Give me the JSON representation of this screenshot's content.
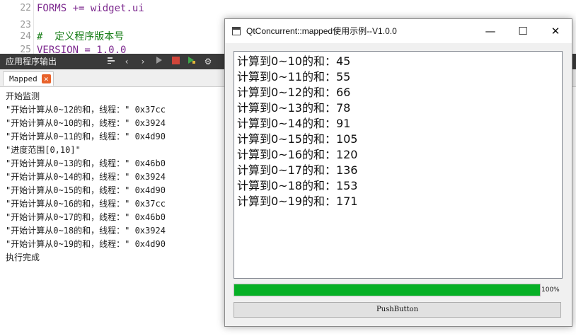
{
  "editor": {
    "lines": [
      {
        "num": "22",
        "text": "FORMS += widget.ui"
      },
      {
        "num": "23",
        "text": ""
      },
      {
        "num": "24",
        "text": "#  定义程序版本号"
      },
      {
        "num": "25",
        "text": "VERSION = 1.0.0"
      }
    ]
  },
  "output_pane": {
    "title": "应用程序输出",
    "tab_label": "Mapped",
    "tab_close": "✕",
    "log_lines": [
      "开始监测",
      "\"开始计算从0~12的和，线程：\" 0x37cc",
      "\"开始计算从0~10的和，线程：\" 0x3924",
      "\"开始计算从0~11的和，线程：\" 0x4d90",
      "\"进度范围[0,10]\"",
      "\"开始计算从0~13的和，线程：\" 0x46b0",
      "\"开始计算从0~14的和，线程：\" 0x3924",
      "\"开始计算从0~15的和，线程：\" 0x4d90",
      "\"开始计算从0~16的和，线程：\" 0x37cc",
      "\"开始计算从0~17的和，线程：\" 0x46b0",
      "\"开始计算从0~18的和，线程：\" 0x3924",
      "\"开始计算从0~19的和，线程：\" 0x4d90",
      "执行完成"
    ]
  },
  "dialog": {
    "title": "QtConcurrent::mapped使用示例--V1.0.0",
    "minimize": "—",
    "maximize": "☐",
    "close": "✕",
    "results": [
      "计算到0~10的和：45",
      "计算到0~11的和：55",
      "计算到0~12的和：66",
      "计算到0~13的和：78",
      "计算到0~14的和：91",
      "计算到0~15的和：105",
      "计算到0~16的和：120",
      "计算到0~17的和：136",
      "计算到0~18的和：153",
      "计算到0~19的和：171"
    ],
    "progress": {
      "value": 100,
      "label": "100%"
    },
    "button_label": "PushButton"
  },
  "colors": {
    "progress_fill": "#06b025",
    "toolbar_bg": "#3a3a3a",
    "tab_close_bg": "#e8622b"
  },
  "icons": {
    "toolbar": [
      "filter-icon",
      "prev-arrow-icon",
      "next-arrow-icon",
      "run-icon",
      "stop-icon",
      "debug-icon",
      "gear-icon"
    ]
  }
}
